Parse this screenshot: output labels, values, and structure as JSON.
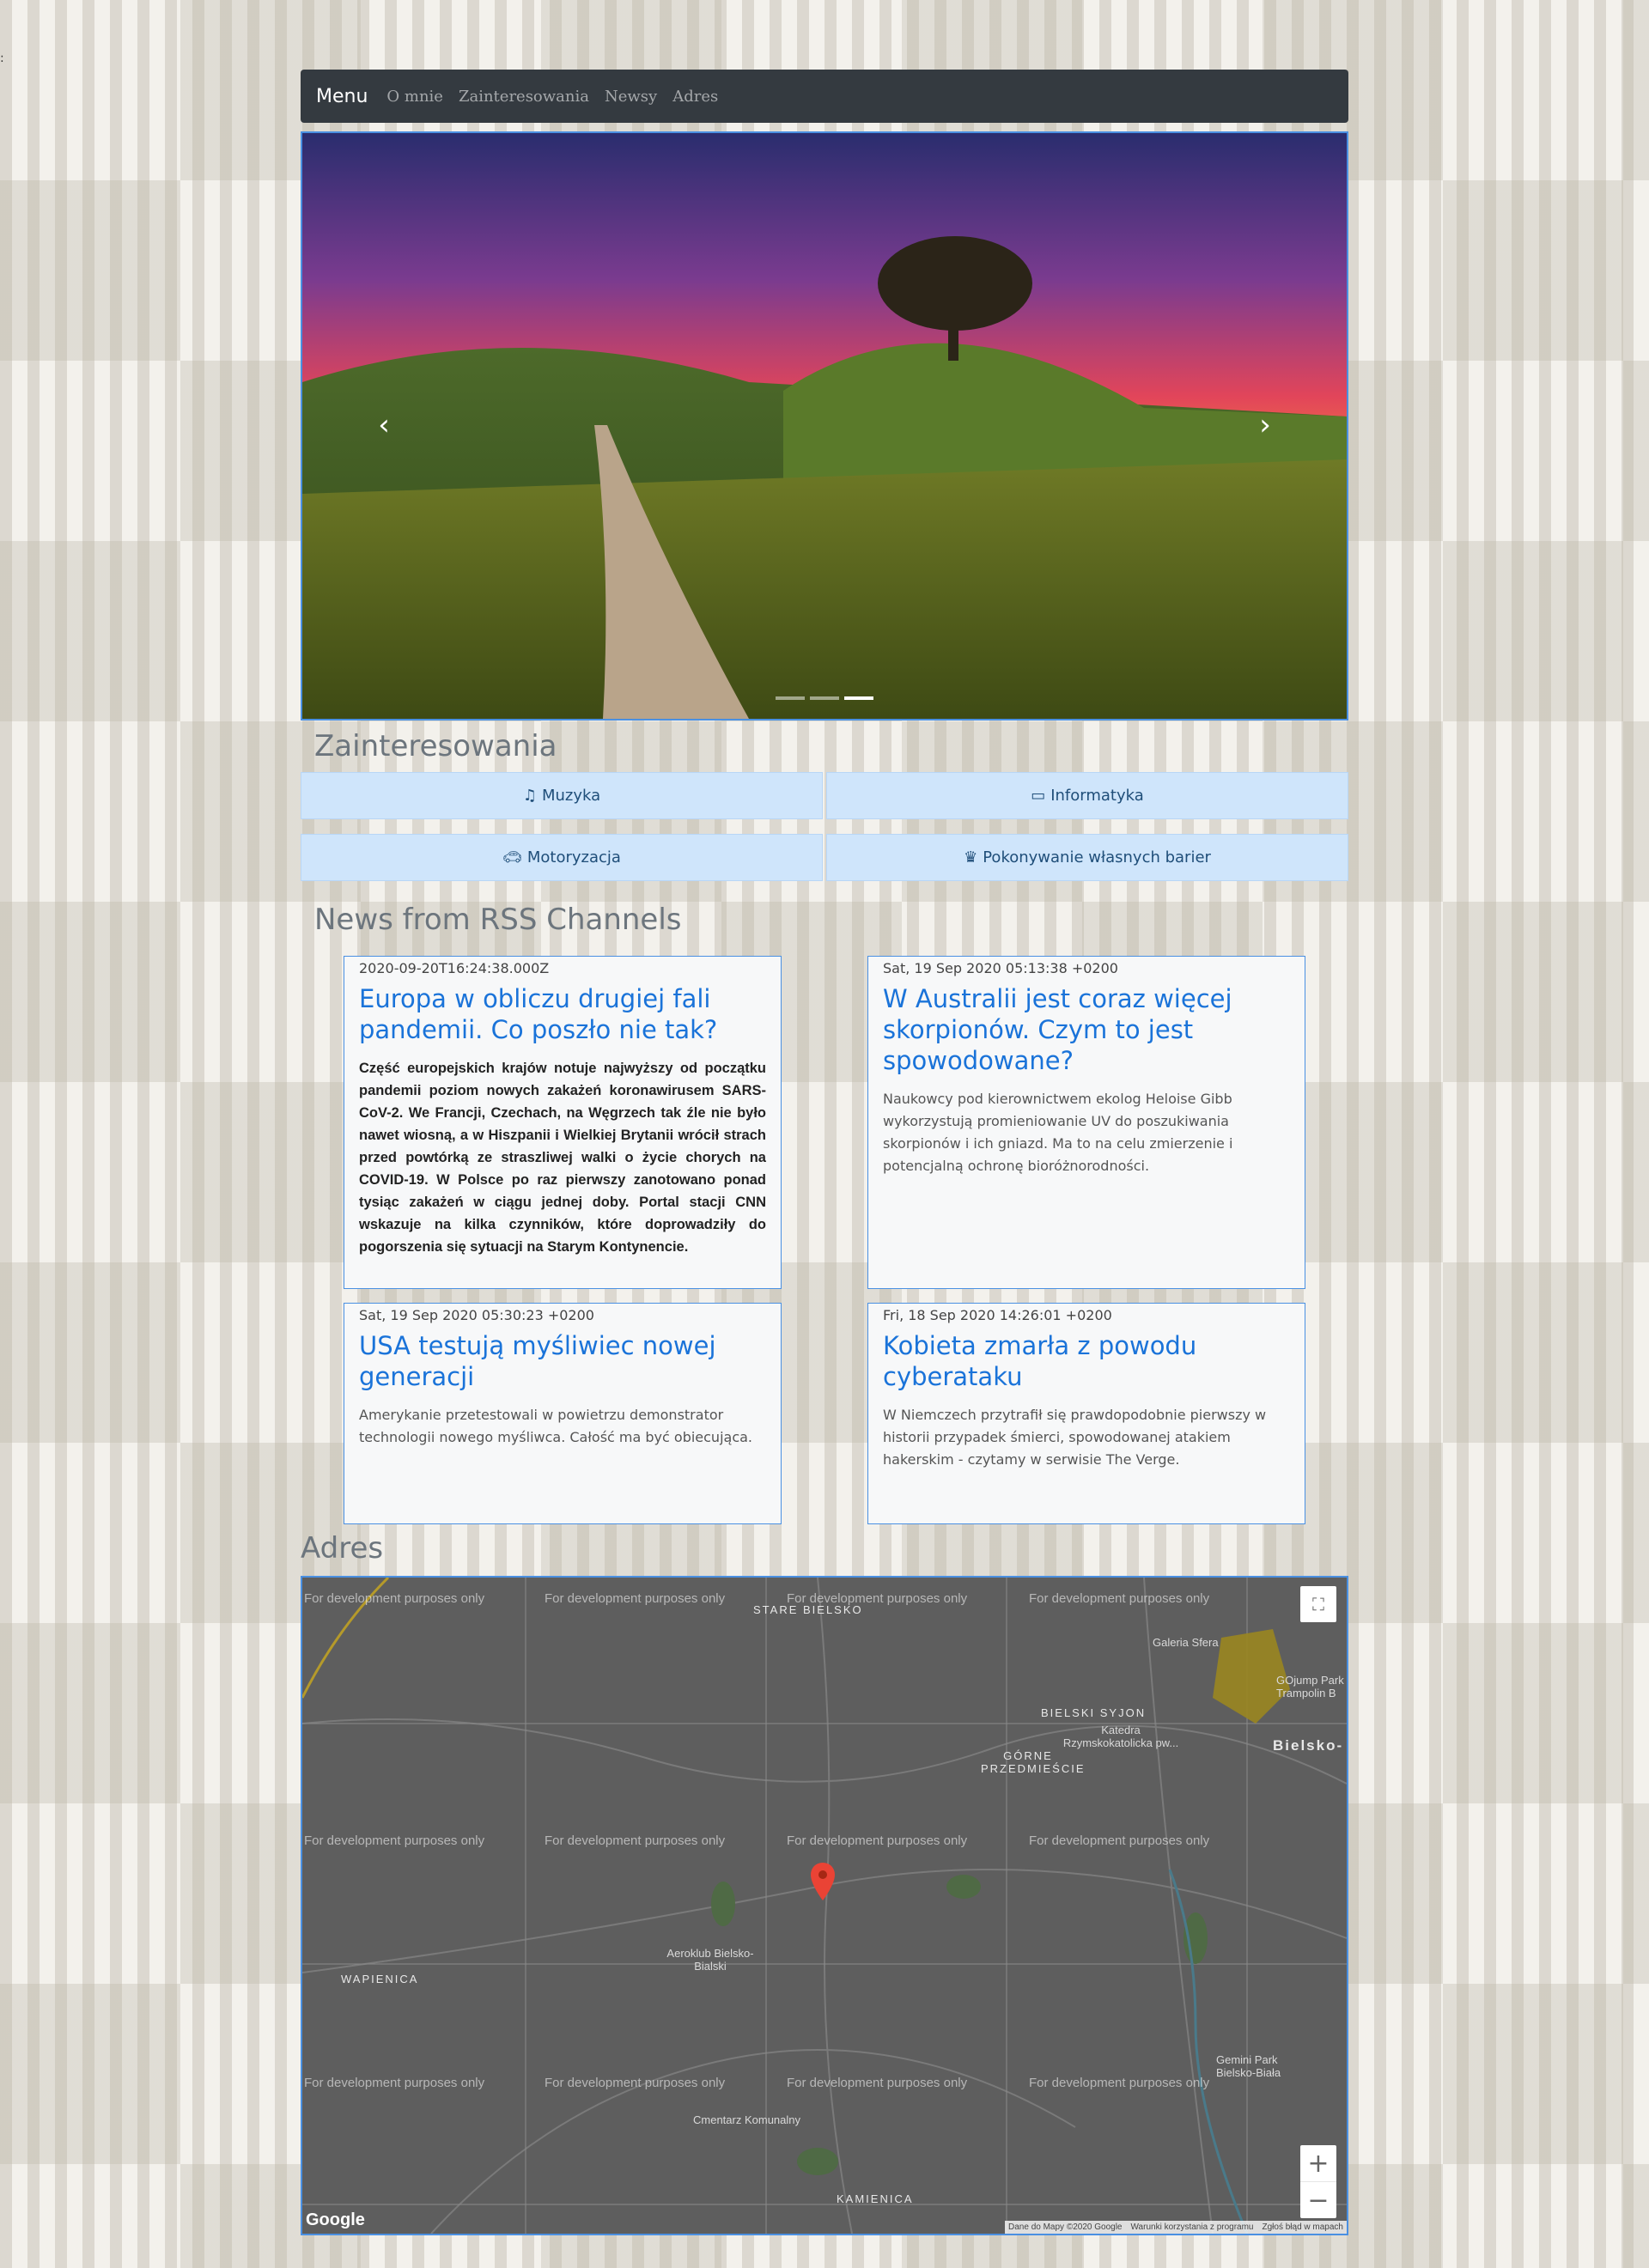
{
  "stray_text": ":",
  "navbar": {
    "brand": "Menu",
    "links": [
      "O mnie",
      "Zainteresowania",
      "Newsy",
      "Adres"
    ]
  },
  "carousel": {
    "prev_icon": "chevron-left-icon",
    "next_icon": "chevron-right-icon",
    "slide_count": 3,
    "active_index": 2
  },
  "interests": {
    "heading": "Zainteresowania",
    "items": [
      {
        "icon": "music-icon",
        "label": "Muzyka"
      },
      {
        "icon": "desktop-icon",
        "label": "Informatyka"
      },
      {
        "icon": "car-icon",
        "label": "Motoryzacja"
      },
      {
        "icon": "trophy-icon",
        "label": "Pokonywanie własnych barier"
      }
    ]
  },
  "news": {
    "heading": "News from RSS Channels",
    "items": [
      {
        "date": "2020-09-20T16:24:38.000Z",
        "title": "Europa w obliczu drugiej fali pandemii. Co poszło nie tak?",
        "description": "Część europejskich krajów notuje najwyższy od początku pandemii poziom nowych zakażeń koronawirusem SARS-CoV-2. We Francji, Czechach, na Węgrzech tak źle nie było nawet wiosną, a w Hiszpanii i Wielkiej Brytanii wrócił strach przed powtórką ze straszliwej walki o życie chorych na COVID-19. W Polsce po raz pierwszy zanotowano ponad tysiąc zakażeń w ciągu jednej doby. Portal stacji CNN wskazuje na kilka czynników, które doprowadziły do pogorszenia się sytuacji na Starym Kontynencie."
      },
      {
        "date": "Sat, 19 Sep 2020 05:13:38 +0200",
        "title": "W Australii jest coraz więcej skorpionów. Czym to jest spowodowane?",
        "description": "Naukowcy pod kierownictwem ekolog Heloise Gibb wykorzystują promieniowanie UV do poszukiwania skorpionów i ich gniazd. Ma to na celu zmierzenie i potencjalną ochronę bioróżnorodności."
      },
      {
        "date": "Sat, 19 Sep 2020 05:30:23 +0200",
        "title": "USA testują myśliwiec nowej generacji",
        "description": "Amerykanie przetestowali w powietrzu demonstrator technologii nowego myśliwca. Całość ma być obiecująca."
      },
      {
        "date": "Fri, 18 Sep 2020 14:26:01 +0200",
        "title": "Kobieta zmarła z powodu cyberataku",
        "description": "W Niemczech przytrafił się prawdopodobnie pierwszy w historii przypadek śmierci, spowodowanej atakiem hakerskim - czytamy w serwisie The Verge."
      }
    ]
  },
  "address": {
    "heading": "Adres",
    "map": {
      "watermark": "For development purposes only",
      "labels": [
        "STARE BIELSKO",
        "BIELSKI SYJON",
        "GÓRNE PRZEDMIEŚCIE",
        "WAPIENICA",
        "KAMIENICA",
        "Bielsko-"
      ],
      "pois": [
        "Galeria Sfera",
        "GOjump Park Trampolin B",
        "Katedra Rzymskokatolicka pw...",
        "Aeroklub Bielsko-Bialski",
        "Cmentarz Komunalny",
        "Gemini Park Bielsko-Biała"
      ],
      "fullscreen_icon": "fullscreen-icon",
      "marker_icon": "map-marker-icon",
      "zoom_in": "+",
      "zoom_out": "−",
      "attribution": [
        "Dane do Mapy ©2020 Google",
        "Warunki korzystania z programu",
        "Zgłoś błąd w mapach"
      ],
      "logo": "Google"
    }
  }
}
